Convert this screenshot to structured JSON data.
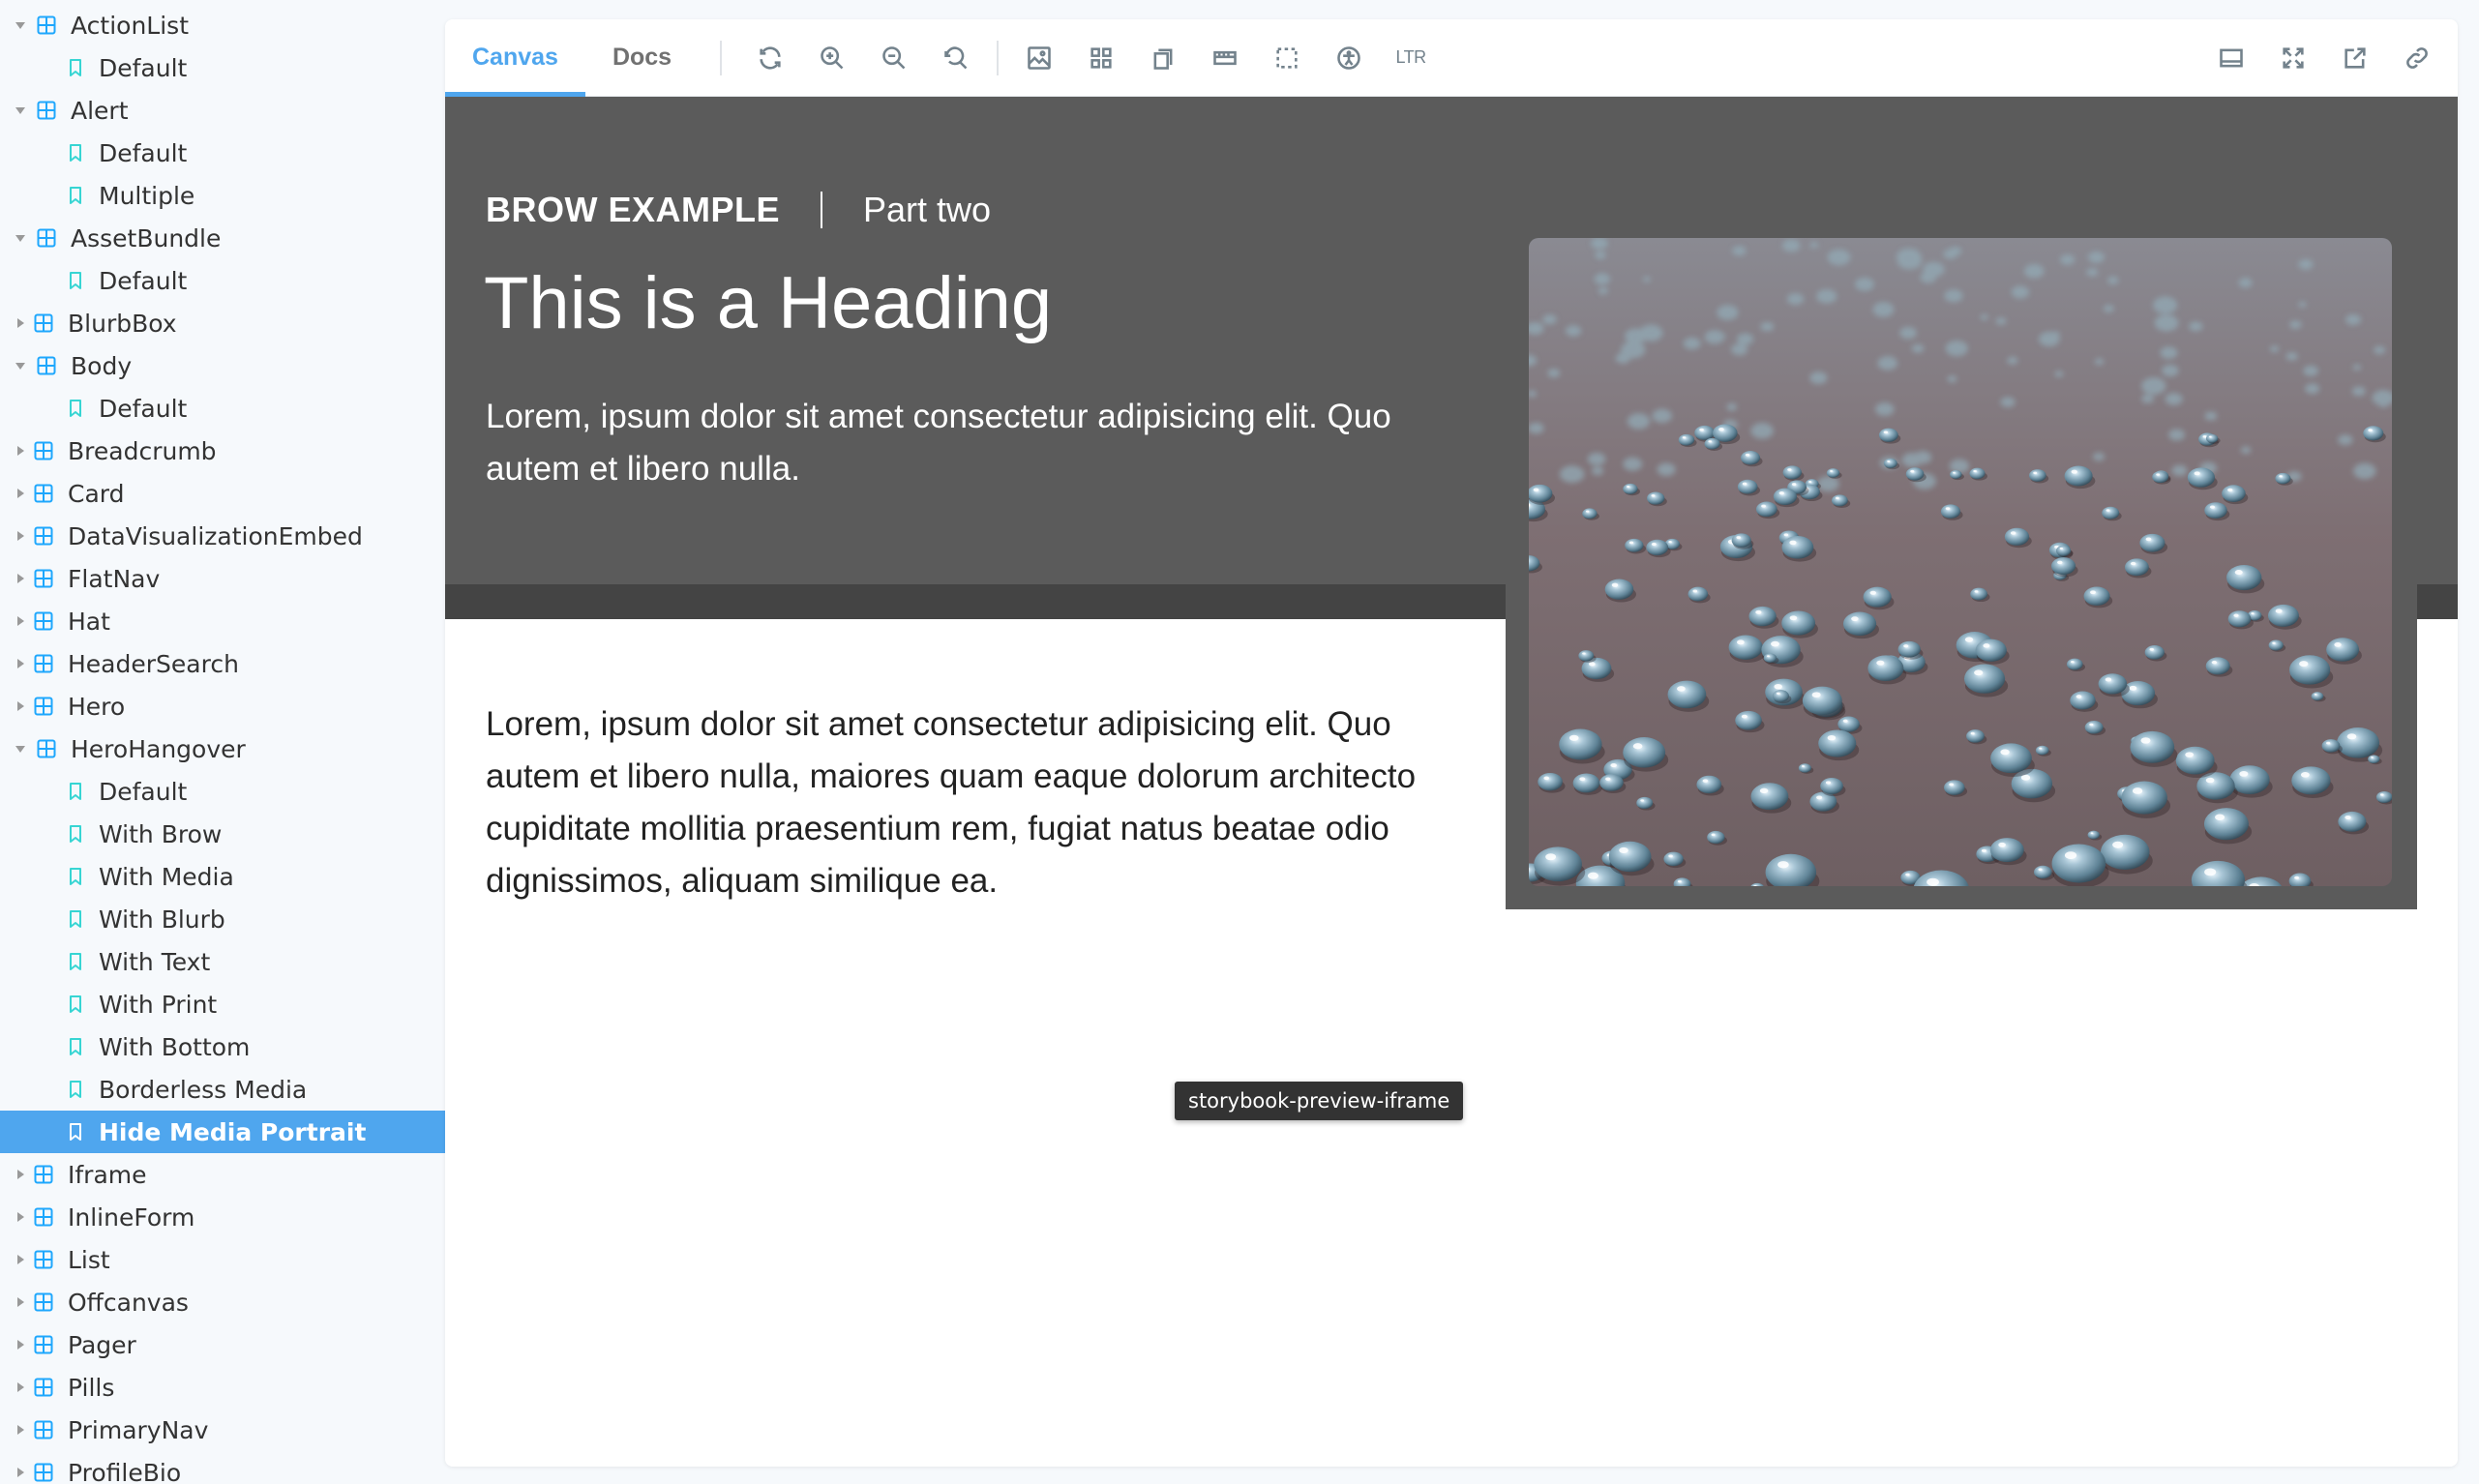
{
  "sidebar": {
    "items": [
      {
        "type": "component",
        "label": "ActionList",
        "expanded": true
      },
      {
        "type": "story",
        "label": "Default"
      },
      {
        "type": "component",
        "label": "Alert",
        "expanded": true
      },
      {
        "type": "story",
        "label": "Default"
      },
      {
        "type": "story",
        "label": "Multiple"
      },
      {
        "type": "component",
        "label": "AssetBundle",
        "expanded": true
      },
      {
        "type": "story",
        "label": "Default"
      },
      {
        "type": "component",
        "label": "BlurbBox",
        "expanded": false
      },
      {
        "type": "component",
        "label": "Body",
        "expanded": true
      },
      {
        "type": "story",
        "label": "Default"
      },
      {
        "type": "component",
        "label": "Breadcrumb",
        "expanded": false
      },
      {
        "type": "component",
        "label": "Card",
        "expanded": false
      },
      {
        "type": "component",
        "label": "DataVisualizationEmbed",
        "expanded": false
      },
      {
        "type": "component",
        "label": "FlatNav",
        "expanded": false
      },
      {
        "type": "component",
        "label": "Hat",
        "expanded": false
      },
      {
        "type": "component",
        "label": "HeaderSearch",
        "expanded": false
      },
      {
        "type": "component",
        "label": "Hero",
        "expanded": false
      },
      {
        "type": "component",
        "label": "HeroHangover",
        "expanded": true
      },
      {
        "type": "story",
        "label": "Default"
      },
      {
        "type": "story",
        "label": "With Brow"
      },
      {
        "type": "story",
        "label": "With Media"
      },
      {
        "type": "story",
        "label": "With Blurb"
      },
      {
        "type": "story",
        "label": "With Text"
      },
      {
        "type": "story",
        "label": "With Print"
      },
      {
        "type": "story",
        "label": "With Bottom"
      },
      {
        "type": "story",
        "label": "Borderless Media"
      },
      {
        "type": "story",
        "label": "Hide Media Portrait",
        "selected": true
      },
      {
        "type": "component",
        "label": "Iframe",
        "expanded": false
      },
      {
        "type": "component",
        "label": "InlineForm",
        "expanded": false
      },
      {
        "type": "component",
        "label": "List",
        "expanded": false
      },
      {
        "type": "component",
        "label": "Offcanvas",
        "expanded": false
      },
      {
        "type": "component",
        "label": "Pager",
        "expanded": false
      },
      {
        "type": "component",
        "label": "Pills",
        "expanded": false
      },
      {
        "type": "component",
        "label": "PrimaryNav",
        "expanded": false
      },
      {
        "type": "component",
        "label": "ProfileBio",
        "expanded": false
      }
    ]
  },
  "toolbar": {
    "tabs": [
      {
        "label": "Canvas",
        "active": true
      },
      {
        "label": "Docs",
        "active": false
      }
    ],
    "tools_left": [
      "reload-icon",
      "zoom-in-icon",
      "zoom-out-icon",
      "zoom-reset-icon",
      "background-icon",
      "grid-icon",
      "viewport-icon",
      "measure-icon",
      "outline-icon",
      "accessibility-icon"
    ],
    "direction_label": "LTR",
    "tools_right": [
      "panel-toggle-icon",
      "fullscreen-icon",
      "open-new-tab-icon",
      "copy-link-icon"
    ]
  },
  "preview": {
    "brow_title": "BROW EXAMPLE",
    "brow_subtitle": "Part two",
    "heading": "This is a Heading",
    "lead": "Lorem, ipsum dolor sit amet consectetur adipisicing elit. Quo autem et libero nulla.",
    "body": "Lorem, ipsum dolor sit amet consectetur adipisicing elit. Quo autem et libero nulla, maiores quam eaque dolorum architecto cupiditate mollitia praesentium rem, fugiat natus beatae odio dignissimos, aliquam similique ea.",
    "media_alt": "water-droplets-photo",
    "tooltip": "storybook-preview-iframe"
  },
  "colors": {
    "accent": "#4fa6ee",
    "hero_bg": "#5b5b5b",
    "hero_band": "#444444",
    "sidebar_bg": "#f6f9fc",
    "component_icon": "#1ea7fd",
    "story_icon": "#37d5d3"
  }
}
